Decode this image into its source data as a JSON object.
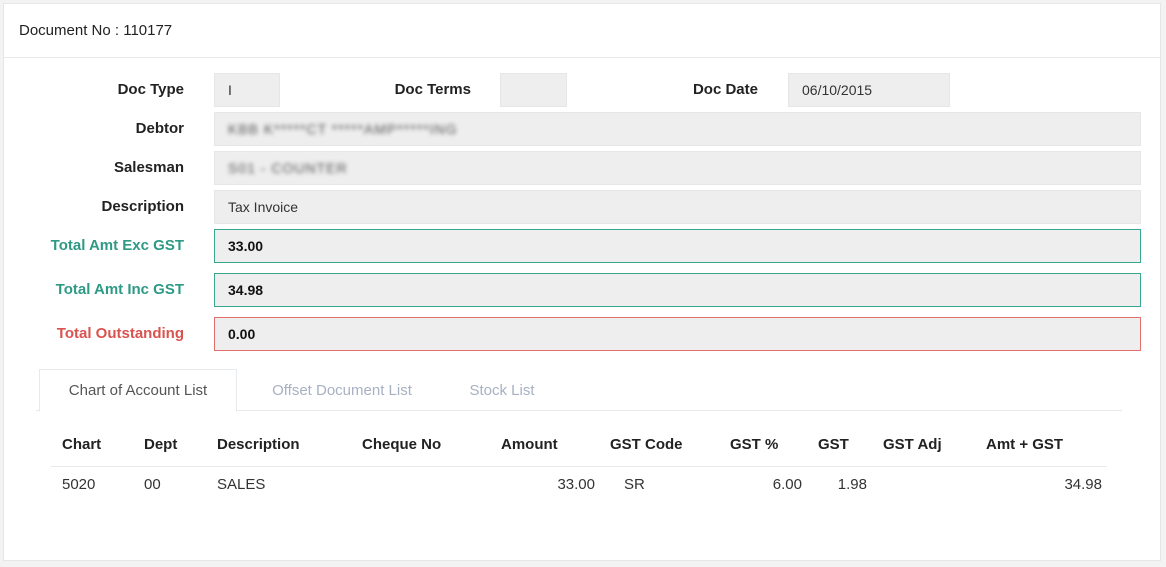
{
  "header": {
    "title": "Document No : 110177"
  },
  "form": {
    "doc_type": {
      "label": "Doc Type",
      "value": "I"
    },
    "doc_terms": {
      "label": "Doc Terms",
      "value": ""
    },
    "doc_date": {
      "label": "Doc Date",
      "value": "06/10/2015"
    },
    "debtor": {
      "label": "Debtor",
      "value": "KBB  K*****CT *****AMP*****ING"
    },
    "salesman": {
      "label": "Salesman",
      "value": "S01 - COUNTER"
    },
    "description": {
      "label": "Description",
      "value": "Tax Invoice"
    },
    "total_exc_gst": {
      "label": "Total Amt Exc GST",
      "value": "33.00"
    },
    "total_inc_gst": {
      "label": "Total Amt Inc GST",
      "value": "34.98"
    },
    "total_outstanding": {
      "label": "Total Outstanding",
      "value": "0.00"
    }
  },
  "tabs": [
    {
      "label": "Chart of Account List",
      "active": true
    },
    {
      "label": "Offset Document List",
      "active": false
    },
    {
      "label": "Stock List",
      "active": false
    }
  ],
  "table": {
    "columns": [
      "Chart",
      "Dept",
      "Description",
      "Cheque No",
      "Amount",
      "GST Code",
      "GST %",
      "GST",
      "GST Adj",
      "Amt + GST"
    ],
    "rows": [
      [
        "5020",
        "00",
        "SALES",
        "",
        "33.00",
        "SR",
        "6.00",
        "1.98",
        "",
        "34.98"
      ]
    ]
  },
  "colors": {
    "accent_green": "#2e9a86",
    "accent_red": "#d9534f",
    "field_bg": "#eeeeee"
  }
}
